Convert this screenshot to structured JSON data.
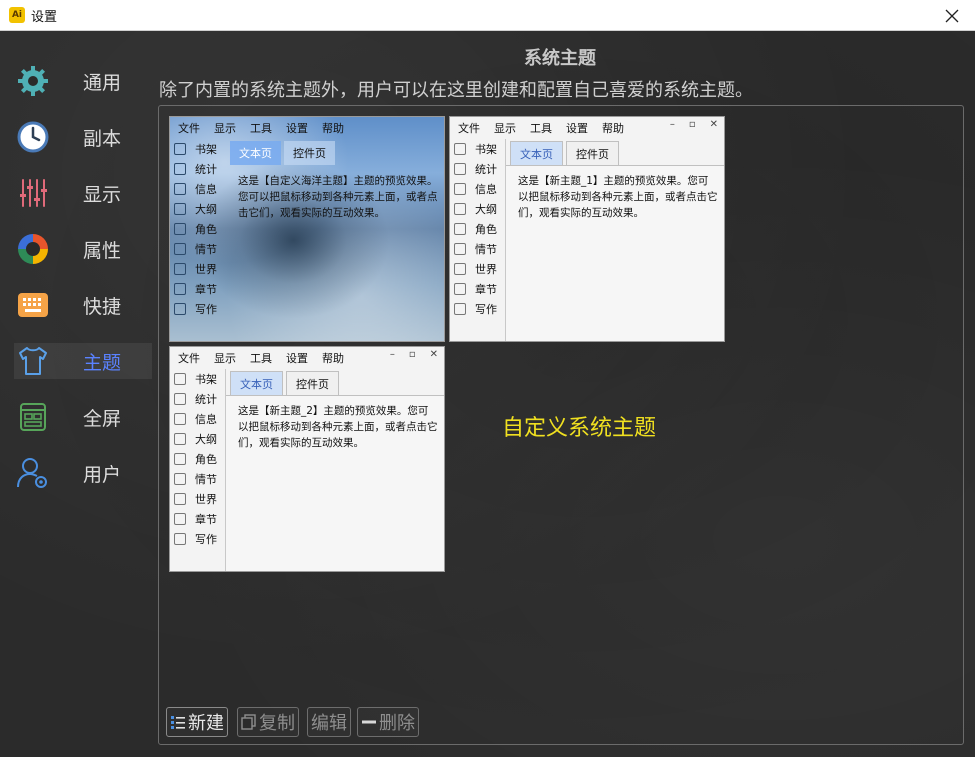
{
  "window": {
    "title": "设置",
    "app_icon_text": "Ai"
  },
  "sidebar": {
    "items": [
      {
        "label": "通用",
        "icon": "gear-icon"
      },
      {
        "label": "副本",
        "icon": "clock-icon"
      },
      {
        "label": "显示",
        "icon": "sliders-icon"
      },
      {
        "label": "属性",
        "icon": "palette-icon"
      },
      {
        "label": "快捷",
        "icon": "keyboard-icon"
      },
      {
        "label": "主题",
        "icon": "tshirt-icon",
        "active": true
      },
      {
        "label": "全屏",
        "icon": "fullscreen-icon"
      },
      {
        "label": "用户",
        "icon": "user-settings-icon"
      }
    ],
    "active_color": "#5a82ff"
  },
  "main": {
    "title": "系统主题",
    "description": "除了内置的系统主题外，用户可以在这里创建和配置自己喜爱的系统主题。",
    "custom_label": "自定义系统主题",
    "custom_label_color": "#f0e020"
  },
  "preview": {
    "menu": [
      "文件",
      "显示",
      "工具",
      "设置",
      "帮助"
    ],
    "side": [
      "书架",
      "统计",
      "信息",
      "大纲",
      "角色",
      "情节",
      "世界",
      "章节",
      "写作"
    ],
    "tabs": [
      "文本页",
      "控件页"
    ],
    "themes": [
      {
        "name": "自定义海洋主题",
        "text": "这是【自定义海洋主题】主题的预览效果。您可以把鼠标移动到各种元素上面，或者点击它们，观看实际的互动效果。"
      },
      {
        "name": "新主题_1",
        "text": "这是【新主题_1】主题的预览效果。您可以把鼠标移动到各种元素上面，或者点击它们，观看实际的互动效果。"
      },
      {
        "name": "新主题_2",
        "text": "这是【新主题_2】主题的预览效果。您可以把鼠标移动到各种元素上面，或者点击它们，观看实际的互动效果。"
      }
    ]
  },
  "buttons": {
    "new": "新建",
    "copy": "复制",
    "edit": "编辑",
    "delete": "删除"
  }
}
